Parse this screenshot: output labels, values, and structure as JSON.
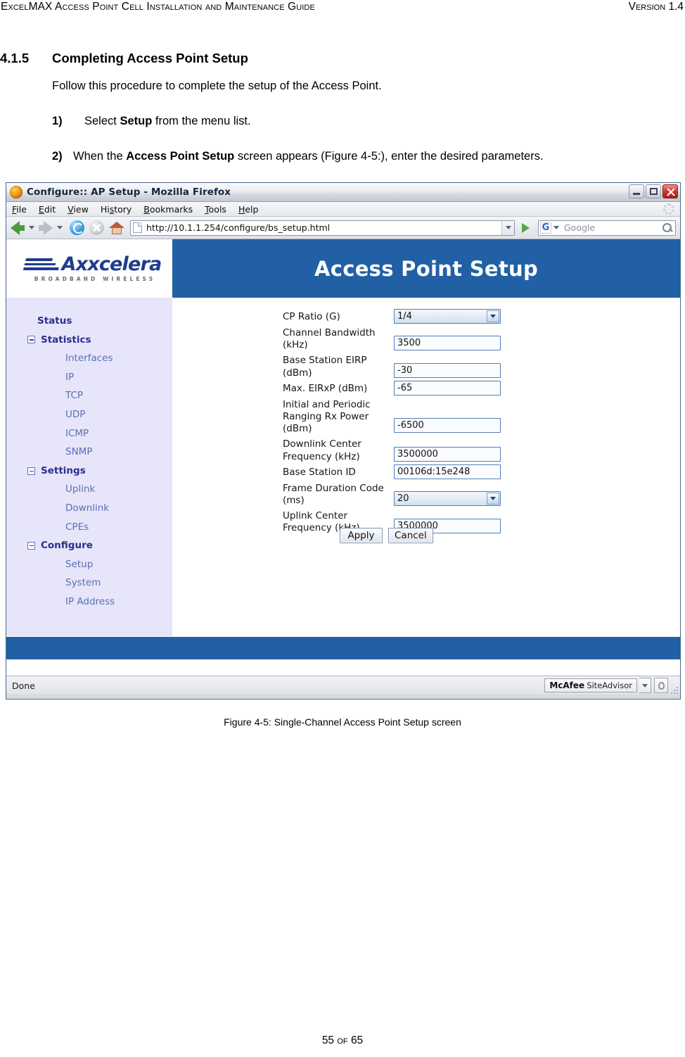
{
  "doc_header": {
    "left": "ExcelMAX Access Point Cell Installation and Maintenance Guide",
    "right": "Version 1.4"
  },
  "section": {
    "number": "4.1.5",
    "title": "Completing Access Point Setup",
    "intro": "Follow this procedure to complete the setup of the Access Point.",
    "steps": [
      {
        "num": "1)",
        "pre": "Select ",
        "bold": "Setup",
        "post": " from the menu list."
      },
      {
        "num": "2)",
        "pre": "When the ",
        "bold": "Access Point Setup",
        "post": " screen appears (Figure 4-5:), enter the desired parameters."
      }
    ]
  },
  "figure": {
    "caption": "Figure 4-5: Single-Channel Access Point Setup screen"
  },
  "page_footer": "55 of 65",
  "browser": {
    "window_title": "Configure:: AP Setup - Mozilla Firefox",
    "menu": [
      "File",
      "Edit",
      "View",
      "History",
      "Bookmarks",
      "Tools",
      "Help"
    ],
    "url": "http://10.1.1.254/configure/bs_setup.html",
    "search_placeholder": "Google",
    "search_engine_letter": "G",
    "status_text": "Done",
    "mcafee": {
      "brand": "McAfee",
      "product": "SiteAdvisor"
    },
    "window_buttons": [
      "minimize",
      "maximize",
      "close"
    ]
  },
  "webpage": {
    "logo": {
      "word": "Axxcelera",
      "tagline": "BROADBAND WIRELESS"
    },
    "banner_title": "Access Point Setup",
    "accent_blue": "#2160a4",
    "sidebar_bg": "#e7e5f9",
    "nav": [
      {
        "label": "Status",
        "level": 0,
        "toggle": false
      },
      {
        "label": "Statistics",
        "level": 1,
        "toggle": true
      },
      {
        "label": "Interfaces",
        "level": 2,
        "toggle": false
      },
      {
        "label": "IP",
        "level": 2,
        "toggle": false
      },
      {
        "label": "TCP",
        "level": 2,
        "toggle": false
      },
      {
        "label": "UDP",
        "level": 2,
        "toggle": false
      },
      {
        "label": "ICMP",
        "level": 2,
        "toggle": false
      },
      {
        "label": "SNMP",
        "level": 2,
        "toggle": false
      },
      {
        "label": "Settings",
        "level": 1,
        "toggle": true
      },
      {
        "label": "Uplink",
        "level": 2,
        "toggle": false
      },
      {
        "label": "Downlink",
        "level": 2,
        "toggle": false
      },
      {
        "label": "CPEs",
        "level": 2,
        "toggle": false
      },
      {
        "label": "Configure",
        "level": 1,
        "toggle": true
      },
      {
        "label": "Setup",
        "level": 2,
        "toggle": false
      },
      {
        "label": "System",
        "level": 2,
        "toggle": false
      },
      {
        "label": "IP Address",
        "level": 2,
        "toggle": false
      }
    ],
    "form": {
      "fields": [
        {
          "label": "CP Ratio (G)",
          "value": "1/4",
          "type": "select",
          "lines": 1
        },
        {
          "label": "Channel Bandwidth (kHz)",
          "value": "3500",
          "type": "text",
          "lines": 2
        },
        {
          "label": "Base Station EIRP (dBm)",
          "value": "-30",
          "type": "text",
          "lines": 2
        },
        {
          "label": "Max. EIRxP (dBm)",
          "value": "-65",
          "type": "text",
          "lines": 1
        },
        {
          "label": "Initial and Periodic Ranging Rx Power (dBm)",
          "value": "-6500",
          "type": "text",
          "lines": 3
        },
        {
          "label": "Downlink Center Frequency (kHz)",
          "value": "3500000",
          "type": "text",
          "lines": 2
        },
        {
          "label": "Base Station ID",
          "value": "00106d:15e248",
          "type": "text",
          "lines": 1
        },
        {
          "label": "Frame Duration Code (ms)",
          "value": "20",
          "type": "select",
          "lines": 2
        },
        {
          "label": "Uplink Center Frequency (kHz)",
          "value": "3500000",
          "type": "text",
          "lines": 2
        }
      ],
      "buttons": [
        {
          "label": "Apply",
          "name": "apply-button"
        },
        {
          "label": "Cancel",
          "name": "cancel-button"
        }
      ]
    }
  }
}
